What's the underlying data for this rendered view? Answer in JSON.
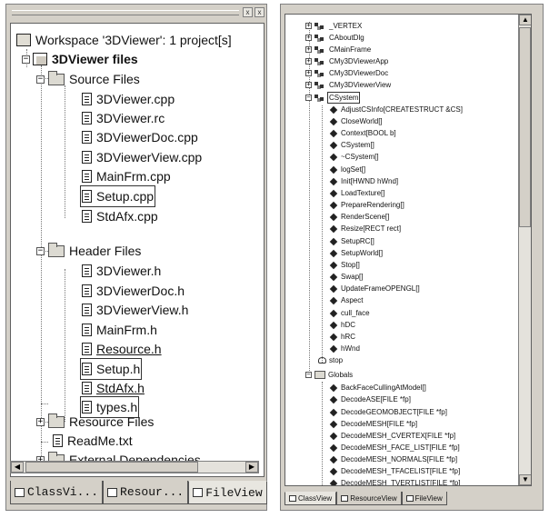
{
  "file_view": {
    "workspace_label": "Workspace '3DViewer': 1 project[s]",
    "project_label": "3DViewer files",
    "groups": {
      "source": "Source Files",
      "header": "Header Files",
      "resource": "Resource Files",
      "external": "External Dependencies"
    },
    "source_files": [
      "3DViewer.cpp",
      "3DViewer.rc",
      "3DViewerDoc.cpp",
      "3DViewerView.cpp",
      "MainFrm.cpp",
      "Setup.cpp",
      "StdAfx.cpp"
    ],
    "header_files": [
      "3DViewer.h",
      "3DViewerDoc.h",
      "3DViewerView.h",
      "MainFrm.h",
      "Resource.h",
      "Setup.h",
      "StdAfx.h",
      "types.h"
    ],
    "readme": "ReadMe.txt",
    "tabs": [
      "ClassVi...",
      "Resour...",
      "FileView"
    ],
    "title_buttons": [
      "x",
      "x"
    ]
  },
  "class_view": {
    "classes": [
      "_VERTEX",
      "CAboutDlg",
      "CMainFrame",
      "CMy3DViewerApp",
      "CMy3DViewerDoc",
      "CMy3DViewerView"
    ],
    "expanded_class": "CSystem",
    "members": [
      "AdjustCSInfo[CREATESTRUCT &CS]",
      "CloseWorld[]",
      "Context[BOOL b]",
      "CSystem[]",
      "~CSystem[]",
      "logSet[]",
      "Init[HWND hWnd]",
      "LoadTexture[]",
      "PrepareRendering[]",
      "RenderScene[]",
      "Resize[RECT rect]",
      "SetupRC[]",
      "SetupWorld[]",
      "Stop[]",
      "Swap[]",
      "UpdateFrameOPENGL[]",
      "Aspect",
      "cull_face",
      "hDC",
      "hRC",
      "hWnd"
    ],
    "stop_label": "stop",
    "globals_label": "Globals",
    "globals": [
      "BackFaceCullingAtModel[]",
      "DecodeASE[FILE *fp]",
      "DecodeGEOMOBJECT[FILE *fp]",
      "DecodeMESH[FILE *fp]",
      "DecodeMESH_CVERTEX[FILE *fp]",
      "DecodeMESH_FACE_LIST[FILE *fp]",
      "DecodeMESH_NORMALS[FILE *fp]",
      "DecodeMESH_TFACELIST[FILE *fp]",
      "DecodeMESH_TVERTLIST[FILE *fp]"
    ],
    "tabs": [
      "ClassView",
      "ResourceView",
      "FileView"
    ]
  }
}
